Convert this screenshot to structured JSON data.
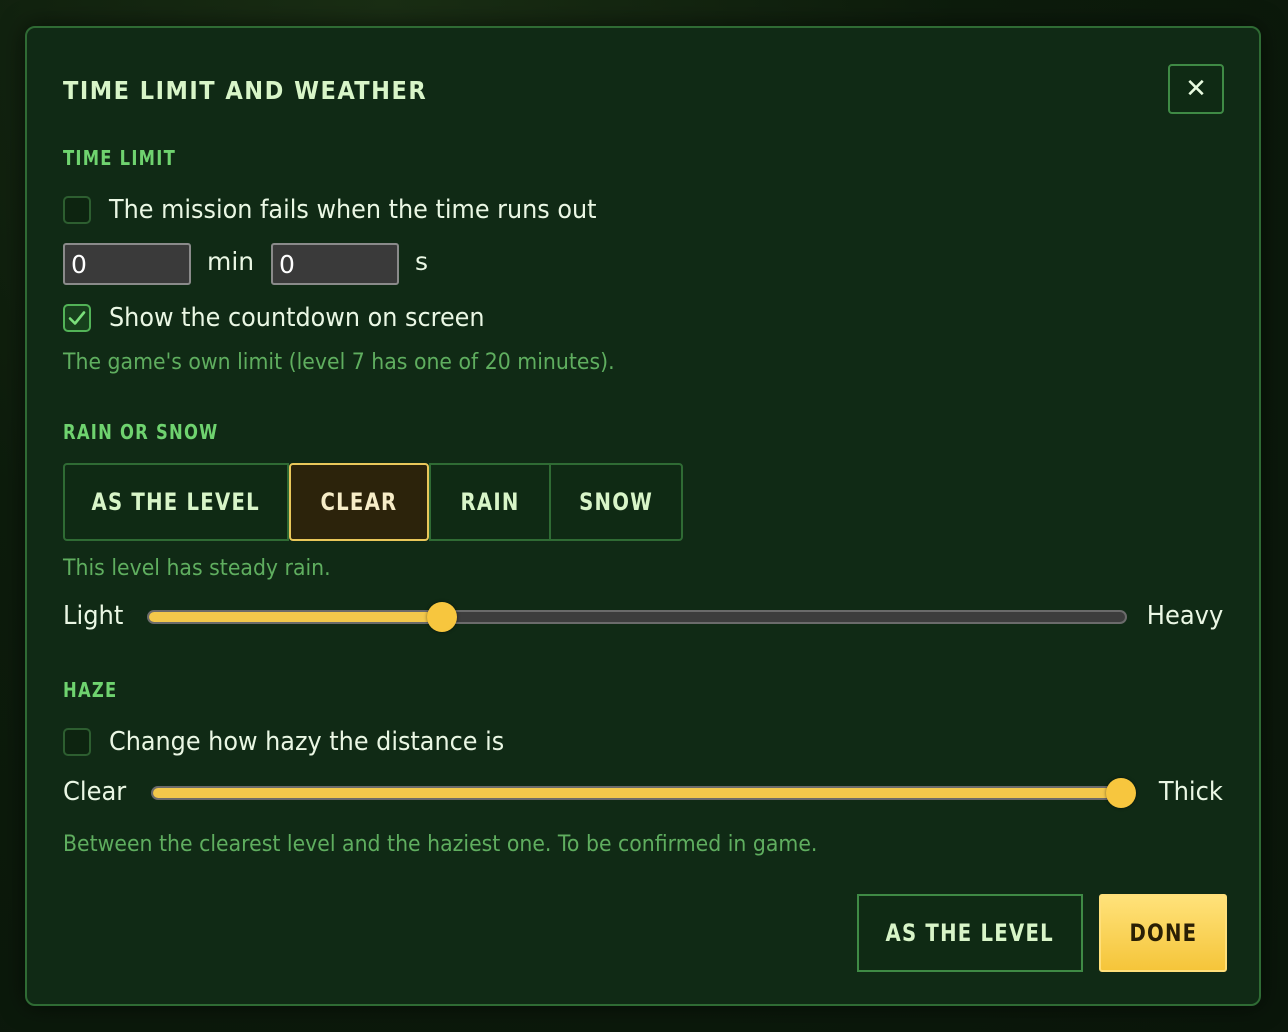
{
  "dialog": {
    "title": "TIME LIMIT AND WEATHER",
    "close_icon": "close-icon",
    "close_glyph": "✕"
  },
  "time_limit": {
    "heading": "TIME LIMIT",
    "fail_checkbox": {
      "label": "The mission fails when the time runs out",
      "checked": false
    },
    "minutes_value": "0",
    "minutes_unit": "min",
    "seconds_value": "0",
    "seconds_unit": "s",
    "countdown_checkbox": {
      "label": "Show the countdown on screen",
      "checked": true
    },
    "note": "The game's own limit (level 7 has one of 20 minutes)."
  },
  "rain_snow": {
    "heading": "RAIN OR SNOW",
    "options": [
      "AS THE LEVEL",
      "CLEAR",
      "RAIN",
      "SNOW"
    ],
    "selected": "CLEAR",
    "note": "This level has steady rain.",
    "intensity": {
      "min_label": "Light",
      "max_label": "Heavy",
      "value_fraction": 0.3
    }
  },
  "haze": {
    "heading": "HAZE",
    "checkbox": {
      "label": "Change how hazy the distance is",
      "checked": false
    },
    "slider": {
      "min_label": "Clear",
      "max_label": "Thick",
      "value_fraction": 1.0
    },
    "note": "Between the clearest level and the haziest one. To be confirmed in game."
  },
  "footer": {
    "reset_label": "AS THE LEVEL",
    "done_label": "DONE"
  },
  "colors": {
    "accent": "#f5c53a",
    "heading_green": "#6fd36f",
    "panel_bg": "#102a15"
  }
}
